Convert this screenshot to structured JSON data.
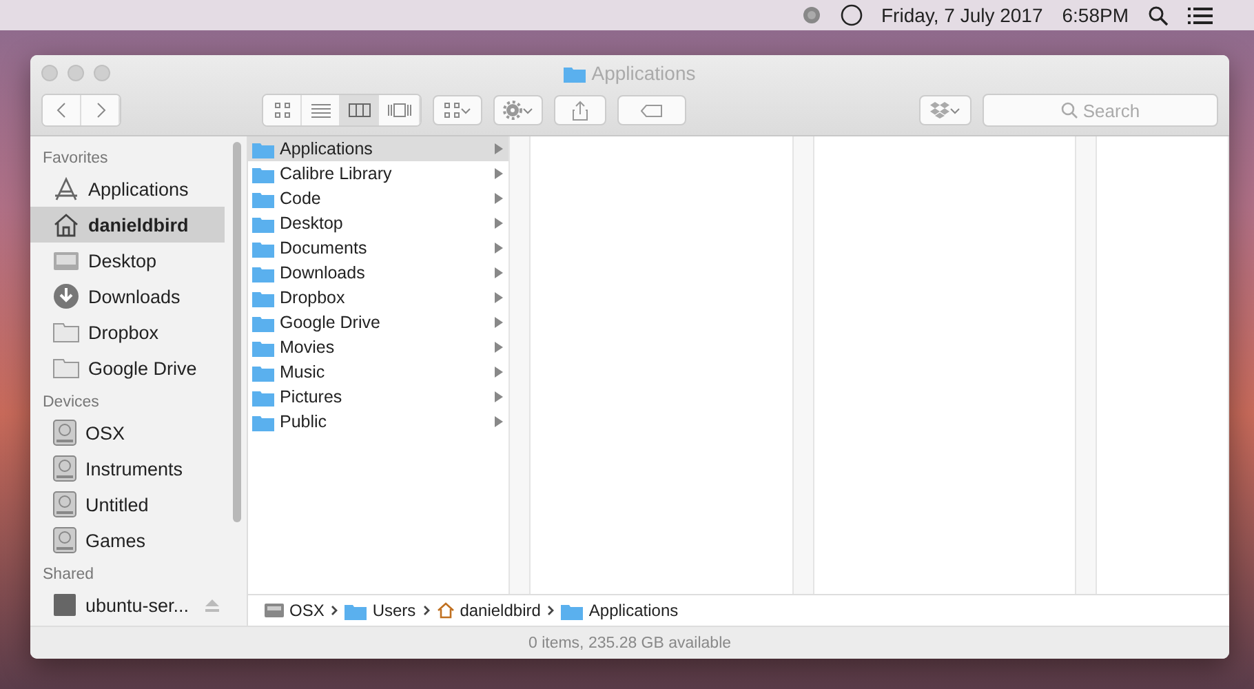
{
  "menu_bar": {
    "date": "Friday, 7 July 2017",
    "time": "6:58PM"
  },
  "window": {
    "title": "Applications"
  },
  "toolbar": {
    "view_modes": [
      {
        "kind": "icons",
        "selected": false
      },
      {
        "kind": "list",
        "selected": false
      },
      {
        "kind": "columns",
        "selected": true
      },
      {
        "kind": "gallery",
        "selected": false
      }
    ],
    "search": {
      "placeholder": "Search"
    }
  },
  "sidebar": {
    "sections": [
      {
        "heading": "Favorites",
        "items": [
          {
            "label": "Applications",
            "kind": "apps",
            "selected": false
          },
          {
            "label": "danieldbird",
            "kind": "home",
            "selected": true
          },
          {
            "label": "Desktop",
            "kind": "desktop",
            "selected": false
          },
          {
            "label": "Downloads",
            "kind": "downloads",
            "selected": false
          },
          {
            "label": "Dropbox",
            "kind": "folder",
            "selected": false
          },
          {
            "label": "Google Drive",
            "kind": "folder",
            "selected": false
          }
        ]
      },
      {
        "heading": "Devices",
        "items": [
          {
            "label": "OSX",
            "kind": "disk",
            "selected": false
          },
          {
            "label": "Instruments",
            "kind": "disk",
            "selected": false
          },
          {
            "label": "Untitled",
            "kind": "disk",
            "selected": false
          },
          {
            "label": "Games",
            "kind": "disk",
            "selected": false
          }
        ]
      },
      {
        "heading": "Shared",
        "items": [
          {
            "label": "ubuntu-ser...",
            "kind": "server",
            "selected": false
          }
        ]
      }
    ]
  },
  "columns": [
    {
      "items": [
        {
          "label": "Applications",
          "selected": true
        },
        {
          "label": "Calibre Library",
          "selected": false
        },
        {
          "label": "Code",
          "selected": false
        },
        {
          "label": "Desktop",
          "selected": false
        },
        {
          "label": "Documents",
          "selected": false
        },
        {
          "label": "Downloads",
          "selected": false
        },
        {
          "label": "Dropbox",
          "selected": false
        },
        {
          "label": "Google Drive",
          "selected": false
        },
        {
          "label": "Movies",
          "selected": false
        },
        {
          "label": "Music",
          "selected": false
        },
        {
          "label": "Pictures",
          "selected": false
        },
        {
          "label": "Public",
          "selected": false
        }
      ]
    }
  ],
  "path_bar": [
    {
      "label": "OSX",
      "kind": "disk"
    },
    {
      "label": "Users",
      "kind": "folder"
    },
    {
      "label": "danieldbird",
      "kind": "home"
    },
    {
      "label": "Applications",
      "kind": "folder"
    }
  ],
  "status_bar": "0 items, 235.28 GB available"
}
